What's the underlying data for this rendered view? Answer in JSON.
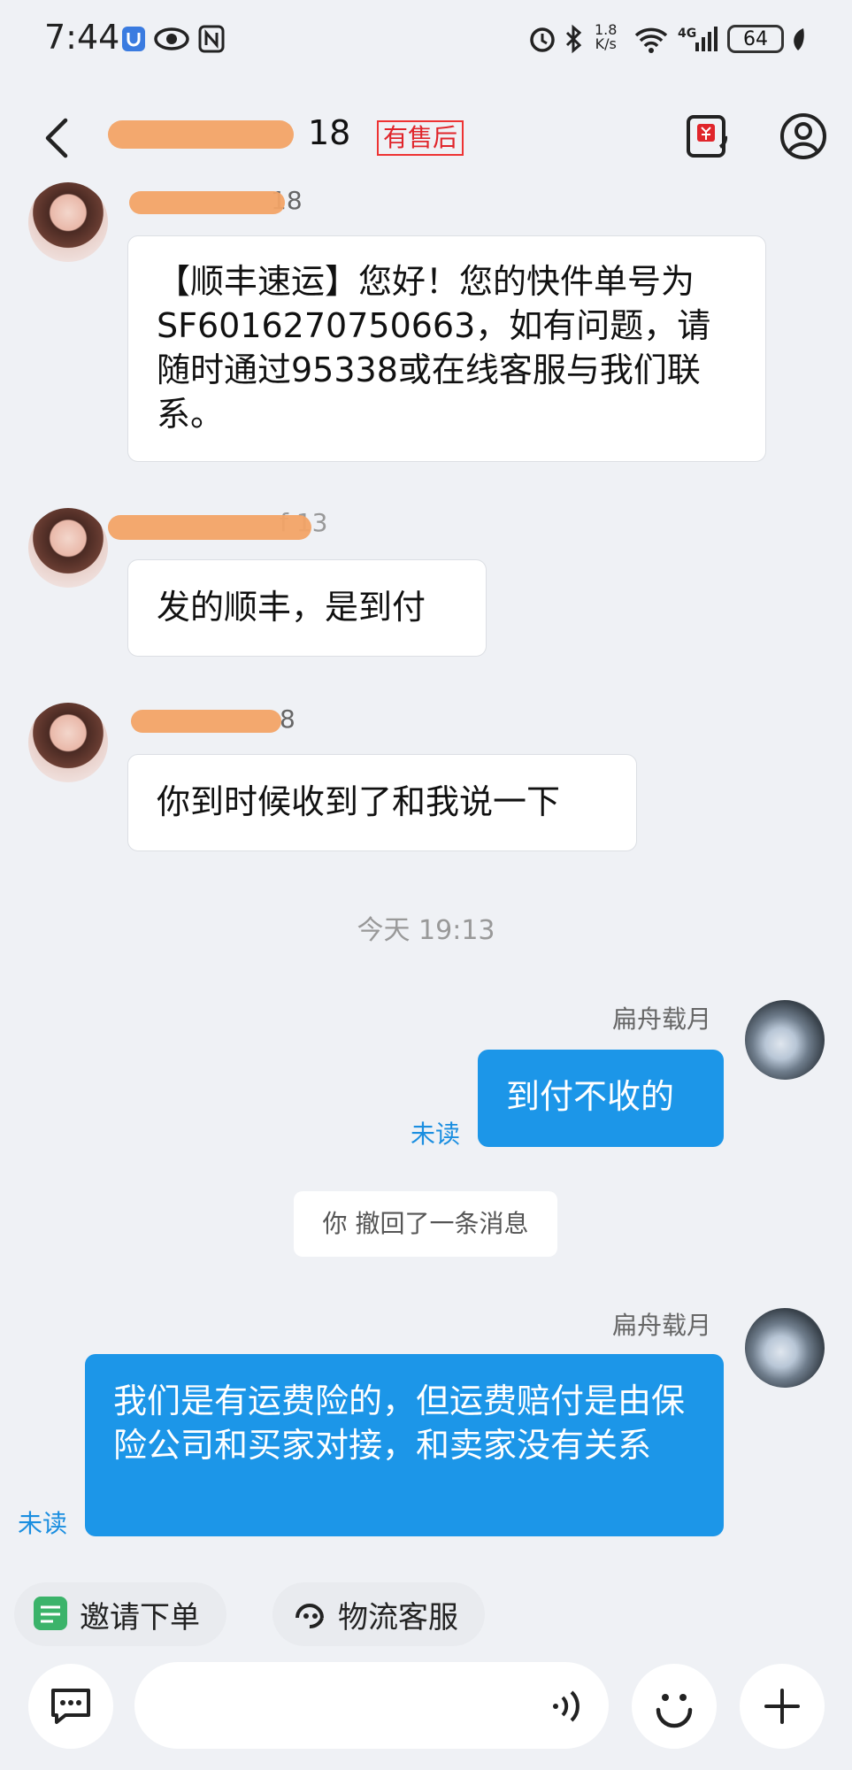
{
  "status_bar": {
    "time": "7:44",
    "network_speed_top": "1.8",
    "network_speed_unit": "K/s",
    "network_type": "4G",
    "battery": "64"
  },
  "header": {
    "contact_name_suffix": "18",
    "after_sale_tag": "有售后"
  },
  "messages": [
    {
      "side": "left",
      "sender_suffix": "18",
      "text": "【顺丰速运】您好！您的快件单号为SF6016270750663，如有问题，请随时通过95338或在线客服与我们联系。"
    },
    {
      "side": "left",
      "sender_suffix": "f 13",
      "text": "发的顺丰，是到付"
    },
    {
      "side": "left",
      "sender_suffix": "8",
      "text": "你到时候收到了和我说一下"
    }
  ],
  "time_separator": "今天  19:13",
  "my_name": "扁舟载月",
  "my_message_1": "到付不收的",
  "my_message_2": "我们是有运费险的，但运费赔付是由保险公司和买家对接，和卖家没有关系",
  "unread_label": "未读",
  "recall_notice": "你 撤回了一条消息",
  "quick_actions": [
    {
      "label": "邀请下单",
      "icon": "order-icon"
    },
    {
      "label": "物流客服",
      "icon": "headset-icon"
    }
  ],
  "colors": {
    "accent_blue": "#1c96e8",
    "tag_red": "#e0252b",
    "background": "#eff1f5"
  }
}
